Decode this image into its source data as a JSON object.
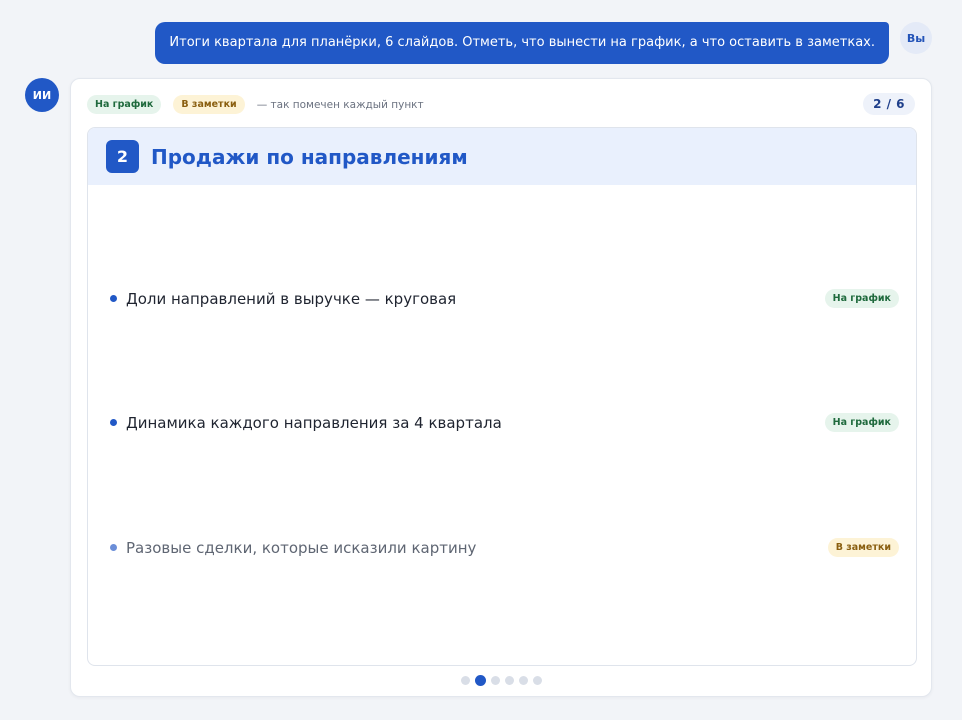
{
  "user": {
    "message": "Итоги квартала для планёрки, 6 слайдов. Отметь, что вынести на график, а что оставить в заметках.",
    "avatar": "Вы"
  },
  "assistant": {
    "avatar": "ИИ"
  },
  "legend": {
    "chart_label": "На график",
    "notes_label": "В заметки",
    "description": "— так помечен каждый пункт"
  },
  "counter": "2 / 6",
  "slide": {
    "number": "2",
    "title": "Продажи по направлениям",
    "bullets": [
      {
        "text": "Доли направлений в выручке — круговая",
        "tag": "На график",
        "kind": "chart"
      },
      {
        "text": "Динамика каждого направления за 4 квартала",
        "tag": "На график",
        "kind": "chart"
      },
      {
        "text": "Разовые сделки, которые исказили картину",
        "tag": "В заметки",
        "kind": "notes"
      }
    ]
  },
  "pagination": {
    "total": 6,
    "current": 2
  },
  "colors": {
    "accent": "#2158c6",
    "chart_tag_bg": "#e6f4ec",
    "chart_tag_text": "#1f6a3d",
    "notes_tag_bg": "#fdf3d6",
    "notes_tag_text": "#8a5f10"
  }
}
